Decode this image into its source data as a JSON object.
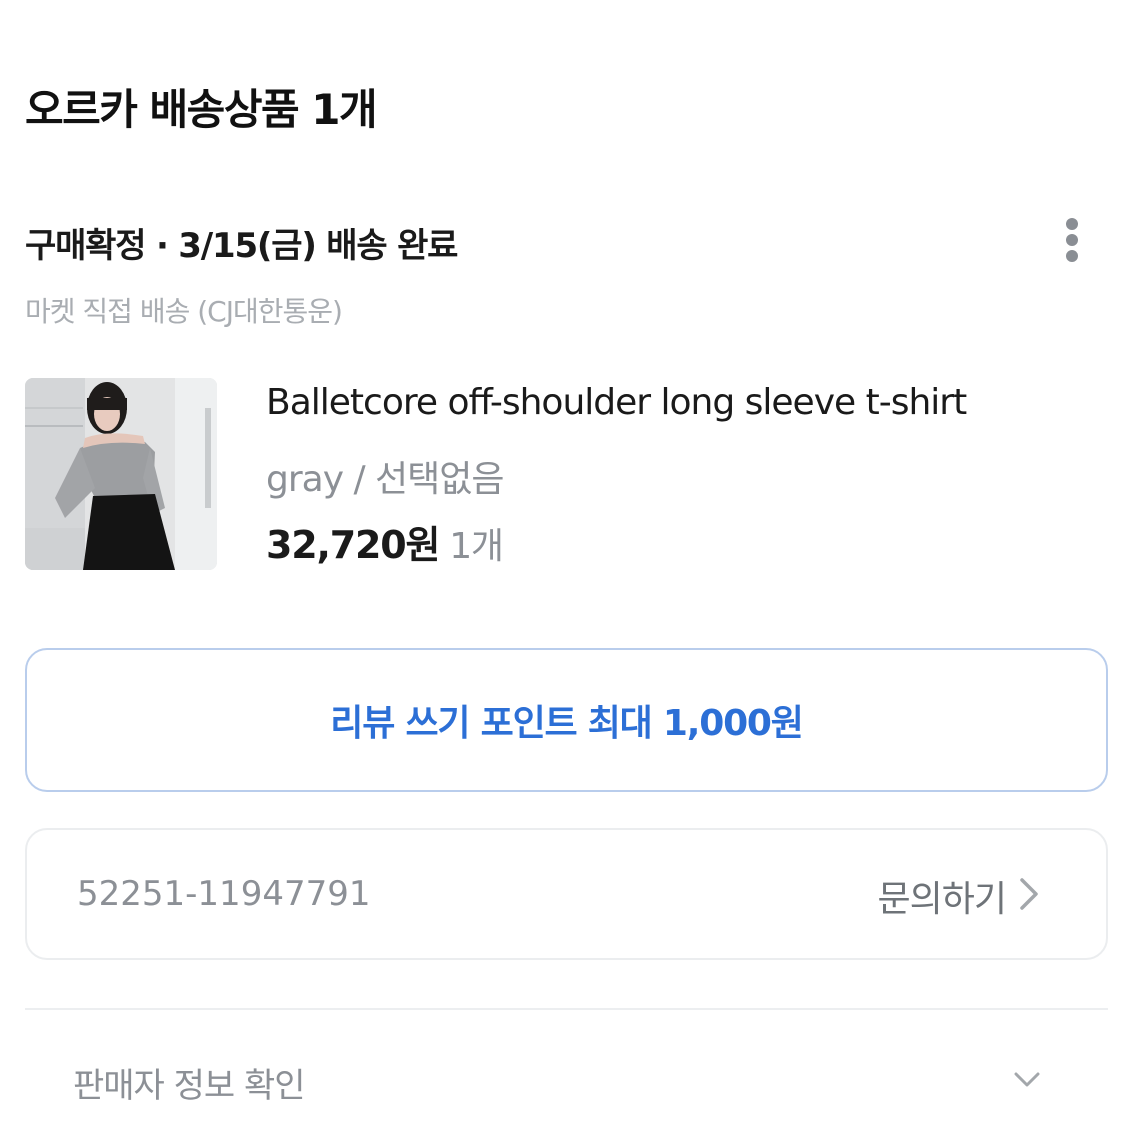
{
  "section": {
    "title": "오르카 배송상품 1개"
  },
  "order": {
    "status": "구매확정 · 3/15(금) 배송 완료",
    "shipping_method": "마켓 직접 배송 (CJ대한통운)",
    "more_icon": "more-vertical-icon"
  },
  "product": {
    "name": "Balletcore off-shoulder long sleeve t-shirt",
    "option": "gray / 선택없음",
    "price": "32,720원",
    "quantity": "1개"
  },
  "review": {
    "label": "리뷰 쓰기 포인트 최대 1,000원",
    "color": "#2c6fd6"
  },
  "inquiry": {
    "order_number": "52251-11947791",
    "label": "문의하기"
  },
  "seller": {
    "label": "판매자 정보 확인"
  }
}
